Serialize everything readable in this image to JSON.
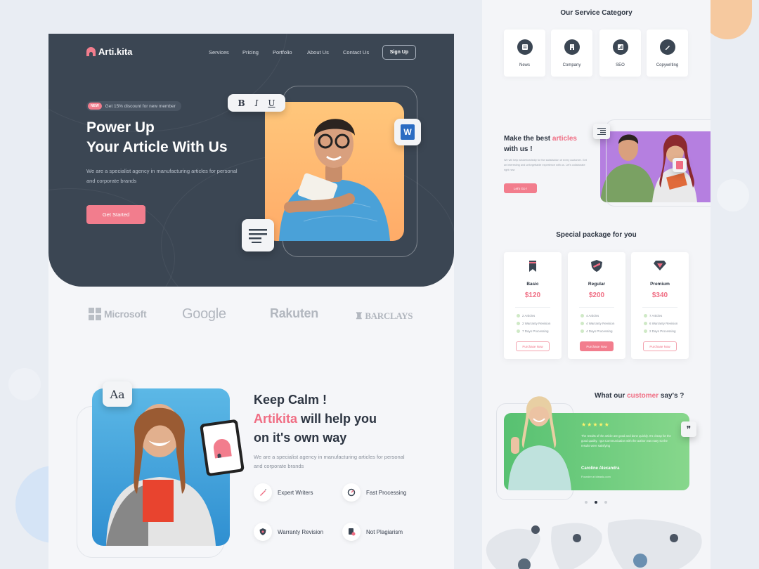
{
  "colors": {
    "accent": "#f27d8d",
    "hero_bg": "#3b4653",
    "testimonial_green": "#6ccf7f"
  },
  "landing": {
    "logo": "Arti.kita",
    "nav": [
      "Services",
      "Pricing",
      "Portfolio",
      "About Us",
      "Contact Us"
    ],
    "signup": "Sign Up",
    "promo_tag": "NEW",
    "promo_text": "Get 15% discount for new member",
    "hero_title_1": "Power Up",
    "hero_title_2": "Your Article With Us",
    "hero_desc": "We are a specialist agency in manufacturing articles for personal and corporate brands",
    "cta": "Get Started",
    "toolbar": {
      "bold": "B",
      "italic": "I",
      "underline": "U"
    },
    "word_icon": "W",
    "brands": [
      "Microsoft",
      "Google",
      "Rakuten",
      "BARCLAYS"
    ],
    "font_badge": "Aa",
    "kc_line1": "Keep Calm !",
    "kc_brand": "Artikita",
    "kc_line2_rest": " will help you",
    "kc_line3": "on it's own way",
    "kc_desc": "We are a specialist agency in manufacturing articles for personal and corporate brands",
    "features": [
      "Expert Writers",
      "Fast Processing",
      "Warranty Revision",
      "Not Plagiarism"
    ]
  },
  "right": {
    "category_title": "Our Service Category",
    "categories": [
      "News",
      "Company",
      "SEO",
      "Copywriting"
    ],
    "make_best_1": "Make the best ",
    "make_best_pink": "articles",
    "make_best_2": "with us !",
    "make_best_desc": "We will help wholeheartedly for the satisfaction of every customer. Get an interesting and unforgettable experience with us. Let's collaborate right now",
    "make_best_btn": "Let's Go !",
    "package_title": "Special package for you",
    "packages": [
      {
        "name": "Basic",
        "price": "$120",
        "f1": "2 Articles",
        "f2": "2 Warranty Revision",
        "f3": "7 Days Processing",
        "btn": "Purchase Now"
      },
      {
        "name": "Regular",
        "price": "$200",
        "f1": "4 Articles",
        "f2": "4 Warranty Revision",
        "f3": "4 Days Processing",
        "btn": "Purchase Now"
      },
      {
        "name": "Premium",
        "price": "$340",
        "f1": "7 Articles",
        "f2": "6 Warranty Revision",
        "f3": "2 Days Processing",
        "btn": "Purchase Now"
      }
    ],
    "testi_title_1": "What our ",
    "testi_title_pink": "customer",
    "testi_title_2": " say's ?",
    "stars": "★★★★★",
    "testi_quote": "The results of the article are good and done quickly. It's cheap for the good quality. I got Communication with the author was easy so the results were satisfying",
    "testi_name": "Caroline Alexandra",
    "testi_role": "Founder at ideaslu.com",
    "quote_mark": "❞"
  }
}
